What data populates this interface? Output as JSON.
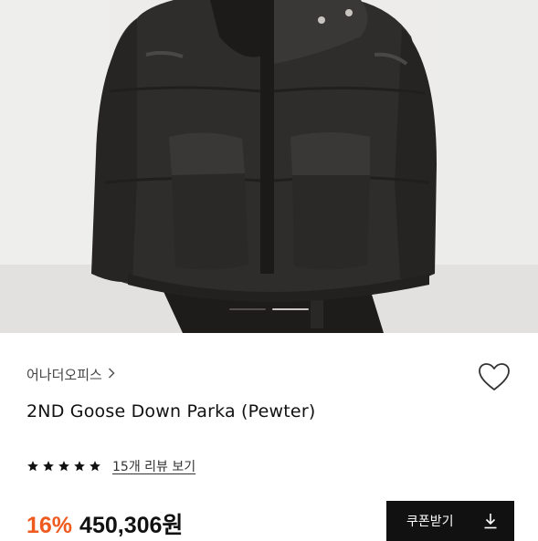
{
  "product": {
    "brand": "어나더오피스",
    "title": "2ND Goose Down Parka (Pewter)",
    "rating_stars": 5,
    "review_link": "15개 리뷰 보기",
    "discount": "16%",
    "price": "450,306원",
    "coupon_button": "쿠폰받기"
  },
  "carousel": {
    "total": 2,
    "active": 1
  },
  "icons": {
    "brand_chevron": "chevron-right-icon",
    "wishlist": "heart-icon",
    "rating": "star-icon",
    "coupon": "download-icon"
  },
  "colors": {
    "discount": "#ef5a1f",
    "button_bg": "#111111",
    "star": "#111111"
  }
}
